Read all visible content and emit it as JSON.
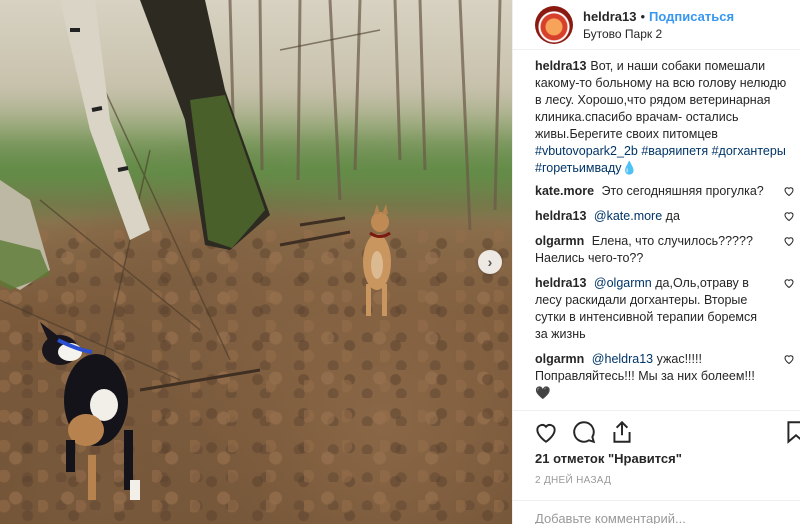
{
  "post": {
    "username": "heldra13",
    "dot": "•",
    "follow_label": "Подписаться",
    "location": "Бутово Парк 2",
    "caption_user": "heldra13",
    "caption_text": "Вот, и наши собаки помешали какому-то больному на всю голову нелюдю в лесу. Хорошо,что рядом ветеринарная клиника.спасибо врачам- остались живы.Берегите своих питомцев",
    "hashtags": [
      "#vbutovopark2_2b",
      "#варяипетя",
      "#догхантеры",
      "#горетьимваду"
    ],
    "hashtag_emoji": "💧"
  },
  "comments": [
    {
      "user": "kate.more",
      "mention": "",
      "text": "Это сегодняшняя прогулка?"
    },
    {
      "user": "heldra13",
      "mention": "@kate.more",
      "text": "да"
    },
    {
      "user": "olgarmn",
      "mention": "",
      "text": "Елена, что случилось????? Наелись чего-то??"
    },
    {
      "user": "heldra13",
      "mention": "@olgarmn",
      "text": "да,Оль,отраву в лесу раскидали догхантеры. Вторые сутки в интенсивной терапии боремся за жизнь"
    },
    {
      "user": "olgarmn",
      "mention": "@heldra13",
      "text": "ужас!!!!! Поправляйтесь!!! Мы за них болеем!!! 🖤"
    }
  ],
  "likes_text": "21 отметок \"Нравится\"",
  "time_ago": "2 ДНЕЙ НАЗАД",
  "comment_placeholder": "Добавьте комментарий...",
  "icons": [
    "heart-icon",
    "comment-icon",
    "share-icon",
    "bookmark-icon",
    "chevron-right-icon"
  ],
  "colors": {
    "accent": "#3897f0",
    "tag": "#003569",
    "muted": "#999999"
  }
}
